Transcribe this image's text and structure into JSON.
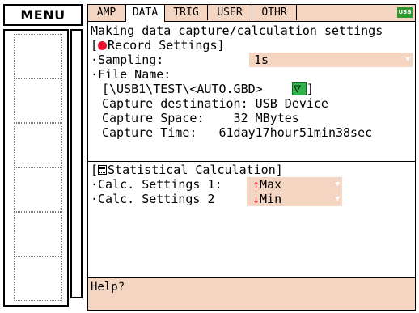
{
  "menu": {
    "label": "MENU",
    "slot_count": 6
  },
  "tabs": [
    {
      "label": "AMP",
      "active": false
    },
    {
      "label": "DATA",
      "active": true
    },
    {
      "label": "TRIG",
      "active": false
    },
    {
      "label": "USER",
      "active": false
    },
    {
      "label": "OTHR",
      "active": false
    }
  ],
  "status_badge": "USB",
  "settings": {
    "heading": "Making data capture/calculation settings",
    "record": {
      "section_label": "[",
      "section_title": "Record Settings]",
      "sampling_label": "·Sampling:",
      "sampling_value": "1s",
      "file_name_label": "·File Name:",
      "file_path": "[\\USB1\\TEST\\<AUTO.GBD>",
      "file_path_close": "]",
      "folder_button_icon": "▽",
      "capture_destination": "Capture destination: USB Device",
      "capture_space": "Capture Space:    32 MBytes",
      "capture_time": "Capture Time:   61day17hour51min38sec"
    },
    "stats": {
      "section_title": "[",
      "section_title_rest": "Statistical Calculation]",
      "calc1_label": "·Calc. Settings 1:",
      "calc1_value": "Max",
      "calc1_icon": "↑",
      "calc2_label": "·Calc. Settings 2",
      "calc2_value": "Min",
      "calc2_icon": "↓"
    }
  },
  "help": {
    "text": "Help?"
  },
  "colors": {
    "accent_bg": "#f4d5c2",
    "record_dot": "#e8112d",
    "folder_button": "#2db34a",
    "usb_badge": "#2e9a2e",
    "calc_icon_red": "#e8112d"
  }
}
